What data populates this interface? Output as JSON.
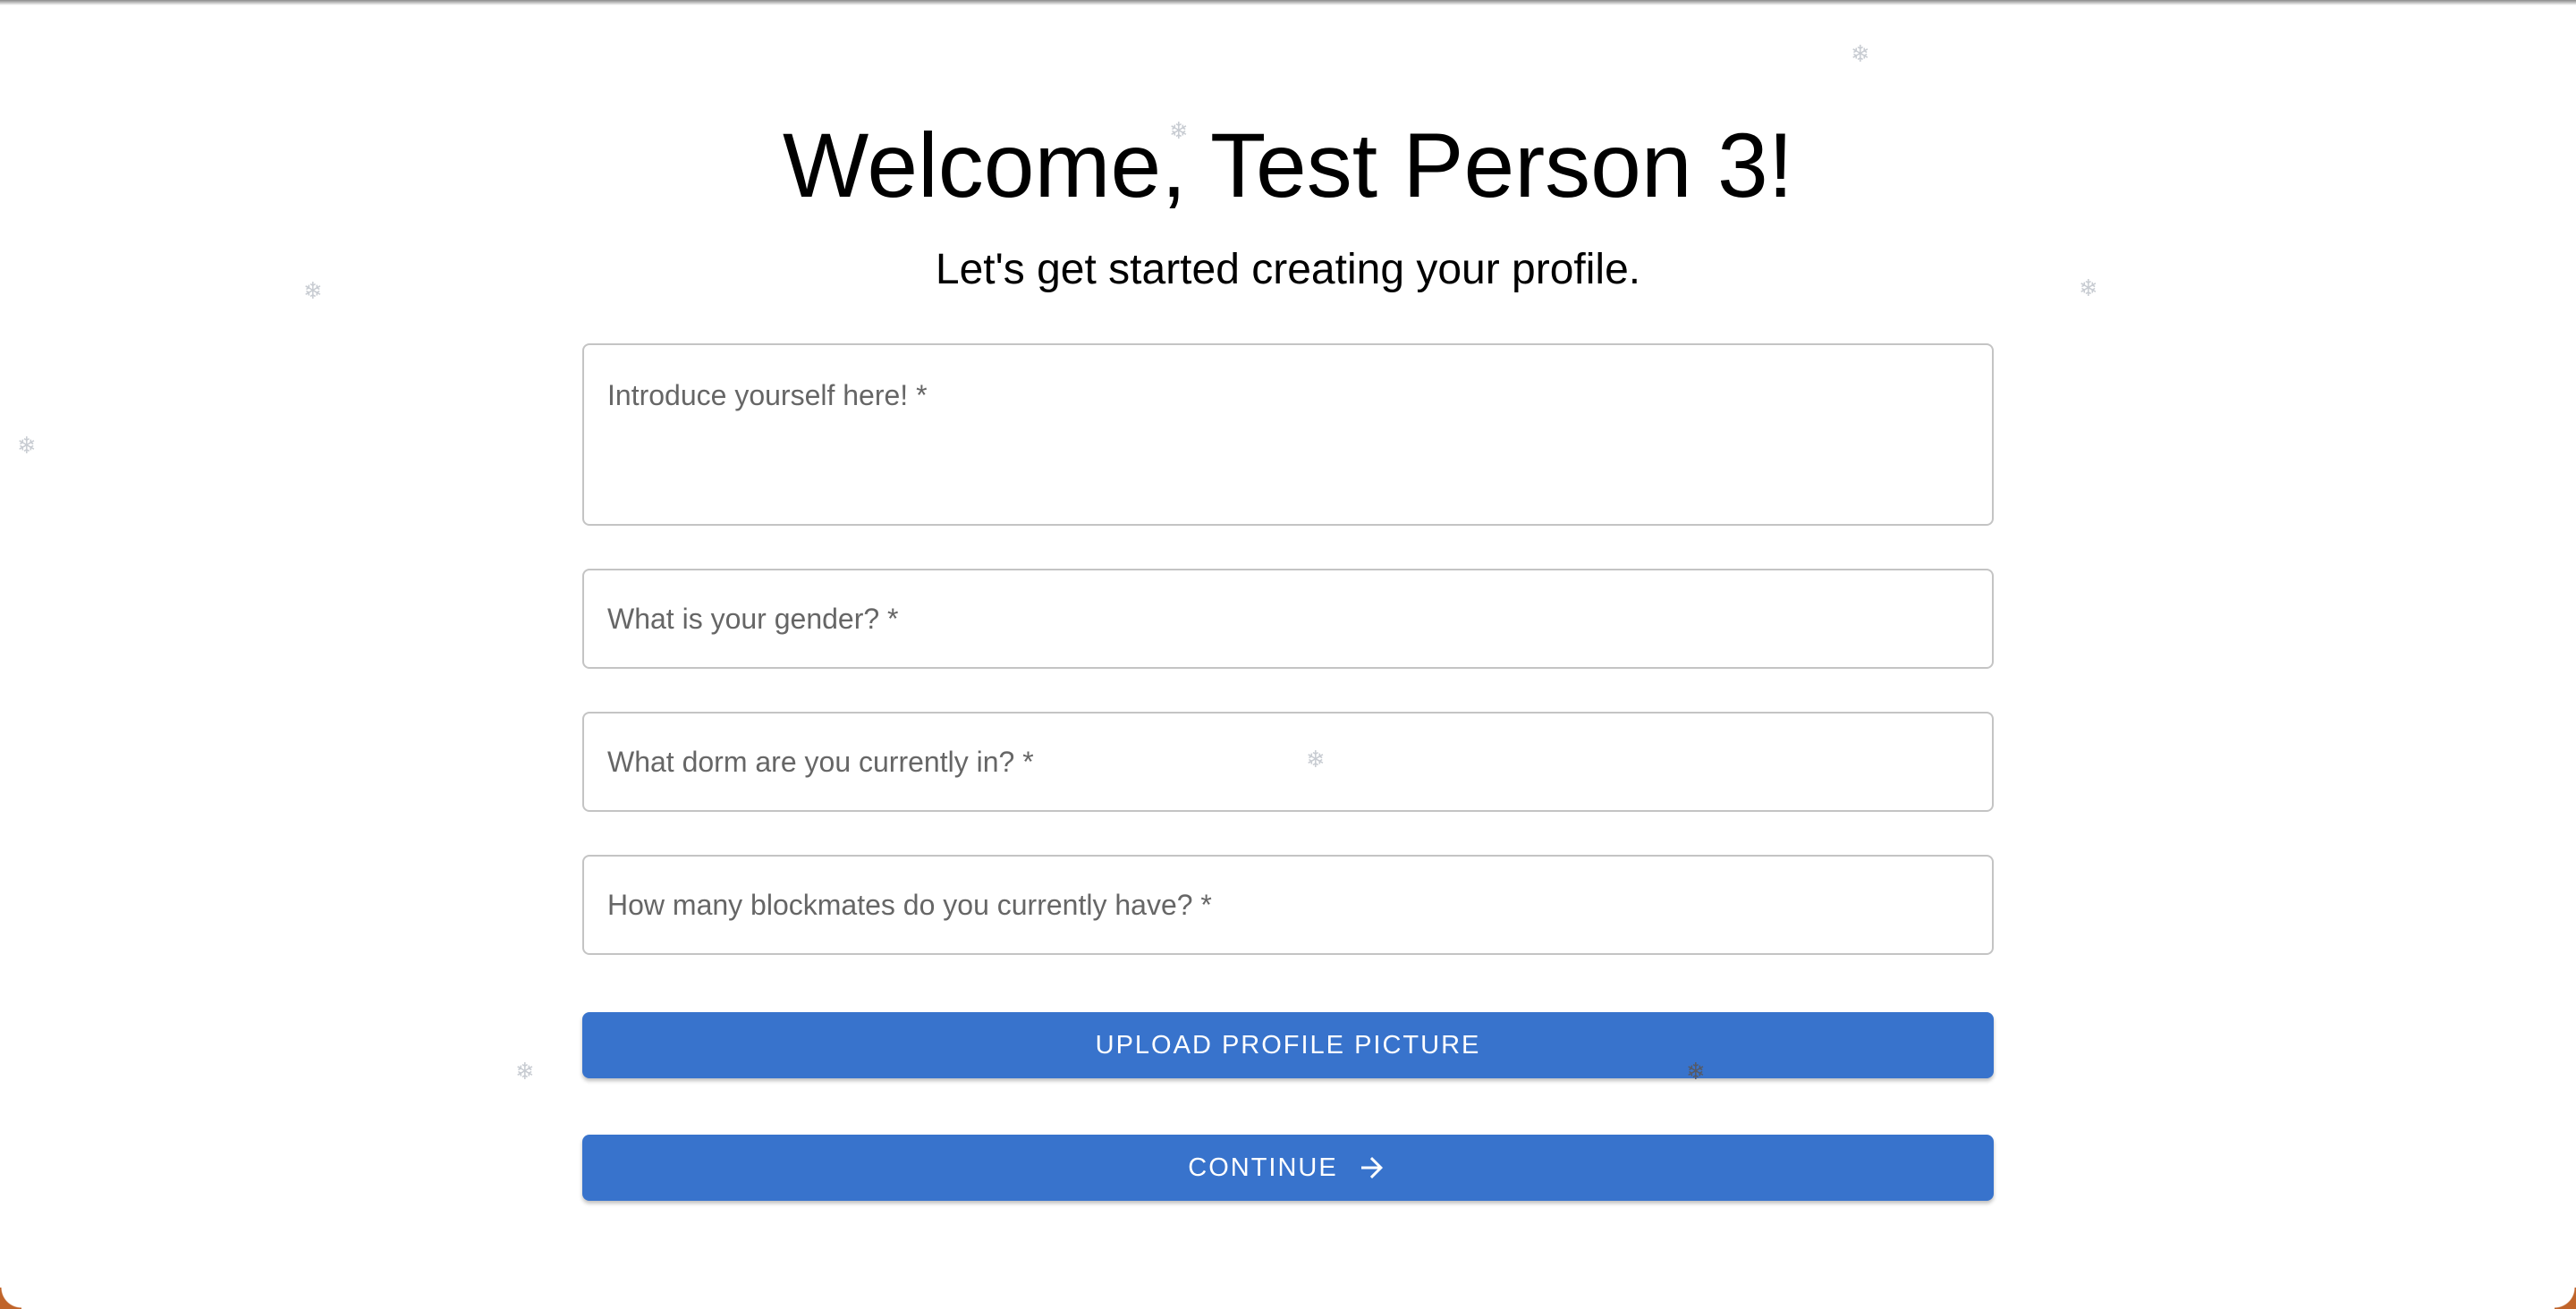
{
  "header": {
    "welcome": "Welcome, Test Person 3!",
    "subtitle": "Let's get started creating your profile."
  },
  "form": {
    "intro_label": "Introduce yourself here! *",
    "gender_label": "What is your gender? *",
    "dorm_label": "What dorm are you currently in? *",
    "blockmates_label": "How many blockmates do you currently have? *",
    "intro_value": "",
    "gender_value": "",
    "dorm_value": "",
    "blockmates_value": ""
  },
  "buttons": {
    "upload_label": "UPLOAD PROFILE PICTURE",
    "continue_label": "CONTINUE",
    "continue_icon": "arrow-right-icon"
  },
  "colors": {
    "button_bg": "#3873cc",
    "button_text": "#ffffff",
    "field_border": "#c4c4c4",
    "label_text": "#666666"
  },
  "decorations": {
    "snowflake_glyph": "❄"
  }
}
